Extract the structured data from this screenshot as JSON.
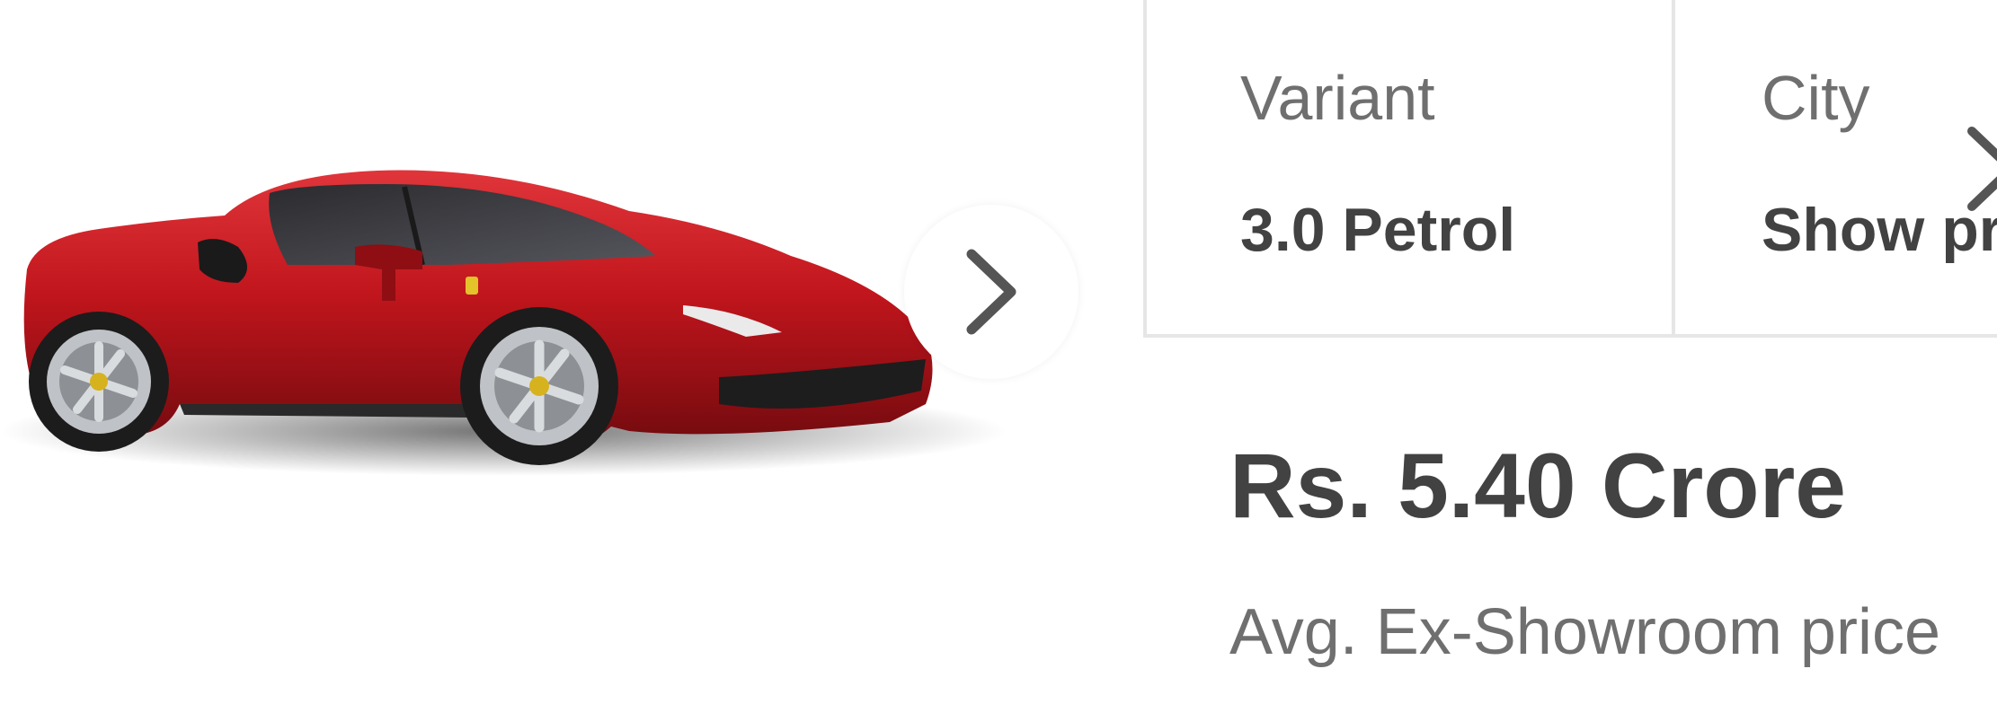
{
  "gallery": {
    "image_subject": "red sports car",
    "next_icon": "chevron-right-icon"
  },
  "selector": {
    "variant_label": "Variant",
    "variant_value": "3.0 Petrol",
    "city_label": "City",
    "city_value": "Show price in my city",
    "arrow_icon": "chevron-right-icon"
  },
  "price": {
    "amount": "Rs. 5.40 Crore",
    "note": "Avg. Ex-Showroom price"
  },
  "colors": {
    "car_red": "#c0151c",
    "text_dark": "#424242",
    "text_muted": "#6f6f6f",
    "border": "#e6e6e6"
  }
}
